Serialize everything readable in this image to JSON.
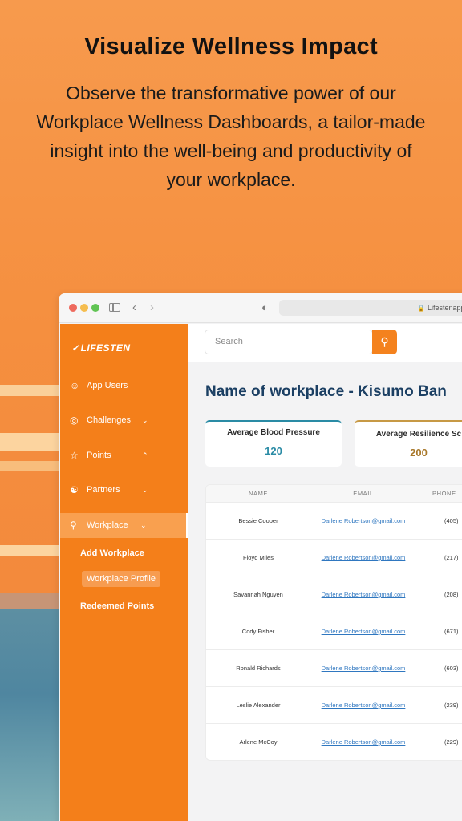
{
  "hero": {
    "title": "Visualize Wellness Impact",
    "subtitle": "Observe the transformative power of our Workplace Wellness Dashboards, a tailor-made insight into the well-being and productivity of your workplace."
  },
  "browser": {
    "url": "Lifestenapp.cm"
  },
  "sidebar": {
    "logo": "LIFESTEN",
    "items": [
      {
        "label": "App Users",
        "icon": "user-icon",
        "chevron": ""
      },
      {
        "label": "Challenges",
        "icon": "target-icon",
        "chevron": "down"
      },
      {
        "label": "Points",
        "icon": "star-icon",
        "chevron": "up"
      },
      {
        "label": "Partners",
        "icon": "partners-icon",
        "chevron": "down"
      },
      {
        "label": "Workplace",
        "icon": "location-icon",
        "chevron": "down"
      }
    ],
    "sub_items": [
      "Add Workplace",
      "Workplace Profile",
      "Redeemed Points"
    ]
  },
  "search": {
    "placeholder": "Search"
  },
  "main": {
    "title": "Name of workplace - Kisumo Ban",
    "stats": [
      {
        "label": "Average Blood Pressure",
        "value": "120",
        "color": "#2a8ba5"
      },
      {
        "label": "Average Resilience Sc",
        "value": "200",
        "color": "#c79945"
      }
    ]
  },
  "table": {
    "columns": [
      "NAME",
      "EMAIL",
      "PHONE"
    ],
    "rows": [
      {
        "name": "Bessie Cooper",
        "email": "Darlene Robertson@gmail.com",
        "phone": "(405)"
      },
      {
        "name": "Floyd Miles",
        "email": "Darlene Robertson@gmail.com",
        "phone": "(217)"
      },
      {
        "name": "Savannah Nguyen",
        "email": "Darlene Robertson@gmail.com",
        "phone": "(208)"
      },
      {
        "name": "Cody Fisher",
        "email": "Darlene Robertson@gmail.com",
        "phone": "(671)"
      },
      {
        "name": "Ronald Richards",
        "email": "Darlene Robertson@gmail.com",
        "phone": "(603)"
      },
      {
        "name": "Leslie Alexander",
        "email": "Darlene Robertson@gmail.com",
        "phone": "(239)"
      },
      {
        "name": "Arlene McCoy",
        "email": "Darlene Robertson@gmail.com",
        "phone": "(229)"
      }
    ]
  },
  "colors": {
    "brand_orange": "#f47f1a",
    "title_navy": "#1b3f63",
    "link_blue": "#2f77c0"
  }
}
